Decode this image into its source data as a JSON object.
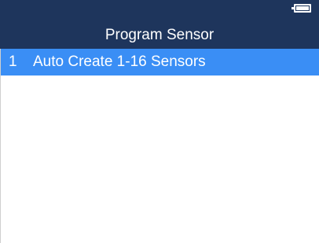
{
  "status_bar": {
    "battery_icon": "battery-icon"
  },
  "header": {
    "title": "Program Sensor",
    "background_color": "#1e355c"
  },
  "menu": {
    "selected_color": "#3a8ef5",
    "items": [
      {
        "index": "1",
        "label": "Auto Create 1-16 Sensors",
        "selected": true
      }
    ]
  }
}
